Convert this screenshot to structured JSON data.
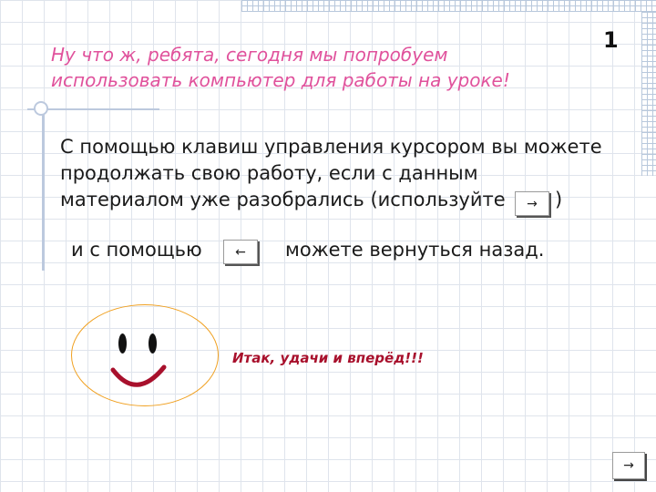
{
  "slide": {
    "number": "1",
    "title_lines": [
      "Ну что ж, ребята, сегодня мы попробуем",
      "использовать компьютер для работы на уроке!"
    ],
    "body": {
      "line1": "С помощью клавиш управления курсором вы можете",
      "line2": "продолжать свою работу, если с данным",
      "line3_before": "материалом уже разобрались (используйте",
      "line3_after": ")",
      "line4_before": "и с помощью",
      "line4_after": "можете вернуться назад."
    },
    "keys": {
      "forward": "→",
      "back": "←"
    },
    "slogan": "Итак, удачи и вперёд!!!",
    "nav": {
      "next": "→"
    }
  },
  "colors": {
    "title": "#e0529c",
    "slogan": "#a8102c",
    "face_outline": "#f0a020",
    "mouth": "#a8102c",
    "grid": "#dfe4ec"
  }
}
